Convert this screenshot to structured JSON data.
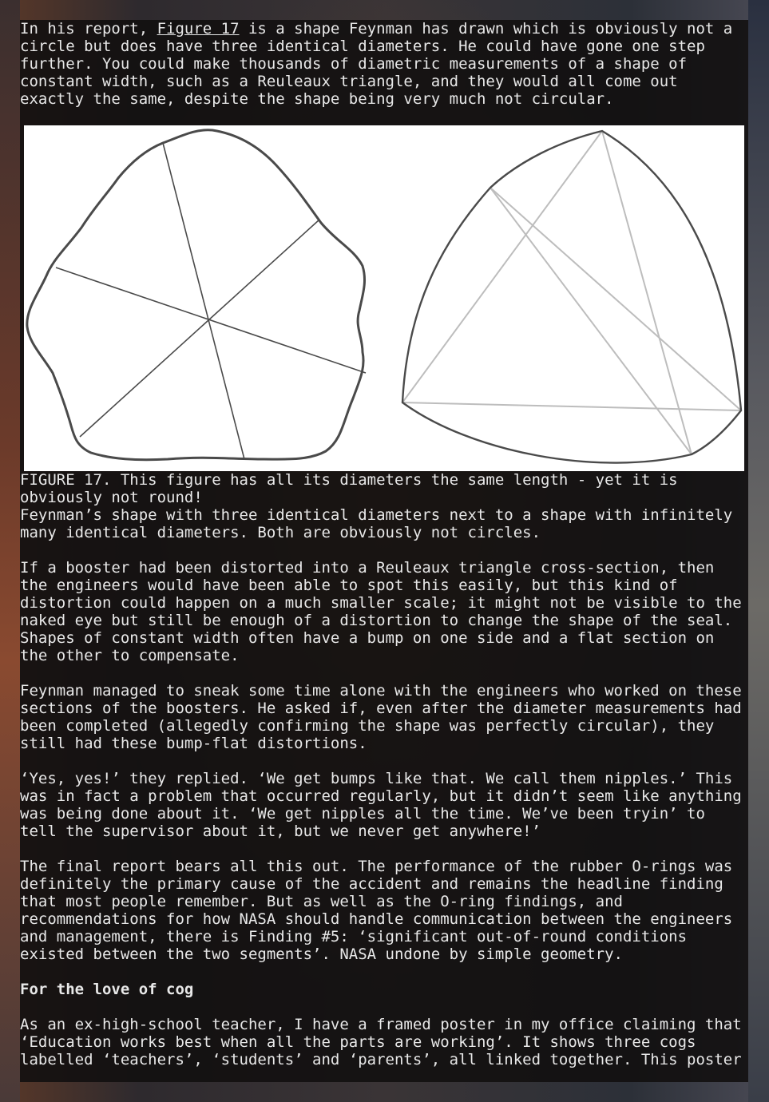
{
  "paragraphs": {
    "p1_before": "In his report, ",
    "p1_link": "Figure 17",
    "p1_after": " is a shape Feynman has drawn which is obviously not a circle but does have three identical diameters. He could have gone one step further. You could make thousands of diametric measurements of a shape of constant width, such as a Reuleaux triangle, and they would all come out exactly the same, despite the shape being very much not circular.",
    "caption_line1": "FIGURE 17. This figure has all its diameters the same length - yet it is obviously not round!",
    "caption_line2": "Feynman’s shape with three identical diameters next to a shape with infinitely many identical diameters. Both are obviously not circles.",
    "p2": "If a booster had been distorted into a Reuleaux triangle cross-section, then the engineers would have been able to spot this easily, but this kind of distortion could happen on a much smaller scale; it might not be visible to the naked eye but still be enough of a distortion to change the shape of the seal. Shapes of constant width often have a bump on one side and a flat section on the other to compensate.",
    "p3": "Feynman managed to sneak some time alone with the engineers who worked on these sections of the boosters. He asked if, even after the diameter measurements had been completed (allegedly confirming the shape was perfectly circular), they still had these bump-flat distortions.",
    "p4": "‘Yes, yes!’ they replied. ‘We get bumps like that. We call them nipples.’ This was in fact a problem that occurred regularly, but it didn’t seem like anything was being done about it. ‘We get nipples all the time. We’ve been tryin’ to tell the supervisor about it, but we never get anywhere!’",
    "p5": "The final report bears all this out. The performance of the rubber O-rings was definitely the primary cause of the accident and remains the headline finding that most people remember. But as well as the O-ring findings, and recommendations for how NASA should handle communication between the engineers and management, there is Finding #5: ‘significant out-of-round conditions existed between the two segments’. NASA undone by simple geometry.",
    "heading": "For the love of cog",
    "p6": "As an ex-high-school teacher, I have a framed poster in my office claiming that ‘Education works best when all the parts are working’. It shows three cogs labelled ‘teachers’, ‘students’ and ‘parents’, all linked together. This poster"
  },
  "colors": {
    "panel_text": "#e8e8e8",
    "figure_background": "#ffffff",
    "shape_outline": "#4a4a4a",
    "reuleaux_diameters": "#bdbdbd"
  }
}
